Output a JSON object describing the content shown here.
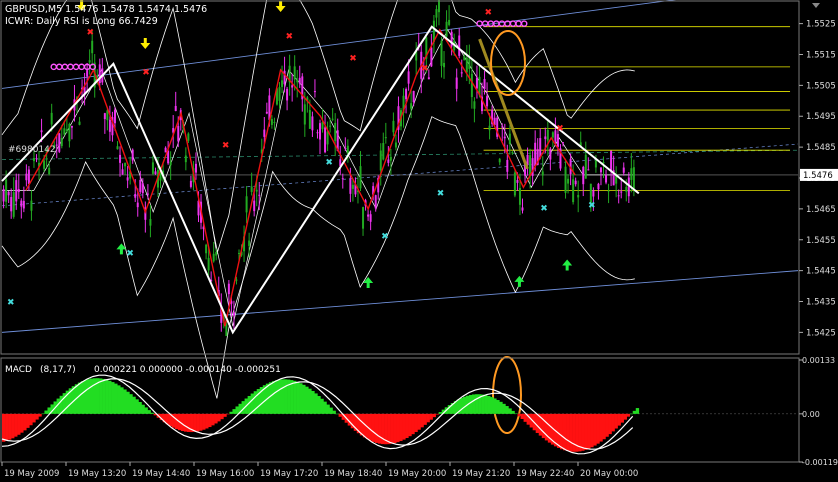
{
  "header": {
    "symbol_line": "GBPUSD,M5  1.5476 1.5478 1.5474 1.5476",
    "indicator_line": "ICWR: Daily RSI is Long 66.7429"
  },
  "level_label": "#6980142",
  "current_price_label": "1.5476",
  "colors": {
    "background": "#000000",
    "bull_candle": "#22aa22",
    "bear_candle": "#ee33ee",
    "zigzag_red": "#ee1111",
    "zigzag_white": "#ffffff",
    "bands": "#ffffff",
    "channel": "#6f8fd9",
    "fib_lines": "#e8e800",
    "macd_pos": "#22dd22",
    "macd_neg": "#ff1111",
    "ellipse": "#ff9922",
    "arrow_down": "#ffee00",
    "arrow_up": "#22ee44",
    "marker_red": "#ff2222",
    "marker_cyan": "#44dddd",
    "peak_beads": "#ff55ff"
  },
  "chart_data": [
    {
      "type": "line",
      "title": "GBPUSD,M5",
      "ylim": [
        1.5418,
        1.5532
      ],
      "y_ticks": [
        "1.5525",
        "1.5515",
        "1.5505",
        "1.5495",
        "1.5485",
        "1.5475",
        "1.5465",
        "1.5455",
        "1.5445",
        "1.5435",
        "1.5425"
      ],
      "y_tick_values": [
        1.5525,
        1.5515,
        1.5505,
        1.5495,
        1.5485,
        1.5475,
        1.5465,
        1.5455,
        1.5445,
        1.5435,
        1.5425
      ],
      "current_price": 1.5476,
      "zigzag": [
        {
          "x": 0.0,
          "y": 1.5474
        },
        {
          "x": 0.14,
          "y": 1.5512
        },
        {
          "x": 0.29,
          "y": 1.5425
        },
        {
          "x": 0.54,
          "y": 1.5524
        },
        {
          "x": 0.8,
          "y": 1.547
        }
      ],
      "zigzag_red": [
        {
          "x": 0.03,
          "y": 1.5471
        },
        {
          "x": 0.115,
          "y": 1.551
        },
        {
          "x": 0.18,
          "y": 1.5464
        },
        {
          "x": 0.225,
          "y": 1.5496
        },
        {
          "x": 0.28,
          "y": 1.5427
        },
        {
          "x": 0.35,
          "y": 1.551
        },
        {
          "x": 0.4,
          "y": 1.5495
        },
        {
          "x": 0.46,
          "y": 1.5465
        },
        {
          "x": 0.52,
          "y": 1.5508
        },
        {
          "x": 0.55,
          "y": 1.5523
        },
        {
          "x": 0.6,
          "y": 1.5502
        },
        {
          "x": 0.655,
          "y": 1.5472
        },
        {
          "x": 0.69,
          "y": 1.5488
        },
        {
          "x": 0.72,
          "y": 1.5476
        }
      ],
      "fib_levels": [
        1.5524,
        1.5511,
        1.5503,
        1.5497,
        1.5491,
        1.5484,
        1.5471
      ],
      "marker_down_arrows": [
        0.1,
        0.18,
        0.35
      ],
      "marker_up_arrows": [
        0.15,
        0.46,
        0.65,
        0.71
      ]
    },
    {
      "type": "bar",
      "title": "MACD",
      "params": "(8,17,7)",
      "values_text": "0.000221 0.000000 -0.000140 -0.000251",
      "ylim": [
        -0.00119,
        0.00133
      ],
      "y_ticks": [
        "0.00133",
        "0.00",
        "-0.00119"
      ],
      "y_tick_values": [
        0.00133,
        0.0,
        -0.00119
      ],
      "x_ticks": [
        "19 May 2009",
        "19 May 13:20",
        "19 May 14:40",
        "19 May 16:00",
        "19 May 17:20",
        "19 May 18:40",
        "19 May 20:00",
        "19 May 21:20",
        "19 May 22:40",
        "20 May 00:00"
      ]
    }
  ]
}
